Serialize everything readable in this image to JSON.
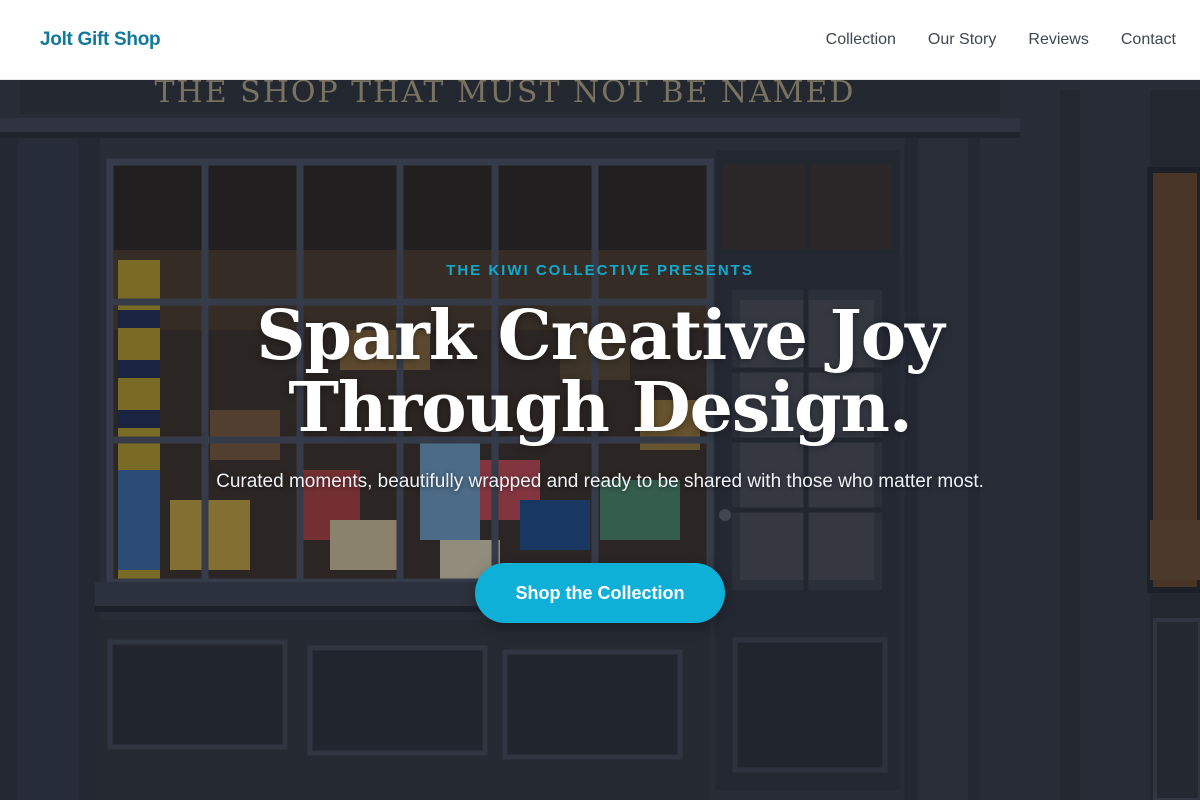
{
  "header": {
    "brand": "Jolt Gift Shop",
    "nav": [
      "Collection",
      "Our Story",
      "Reviews",
      "Contact"
    ]
  },
  "hero": {
    "sign_text": "THE SHOP THAT MUST NOT BE NAMED",
    "eyebrow": "THE KIWI COLLECTIVE PRESENTS",
    "headline_line1": "Spark Creative Joy",
    "headline_line2": "Through Design.",
    "subtext": "Curated moments, beautifully wrapped and ready to be shared with those who matter most.",
    "cta_label": "Shop the Collection"
  },
  "colors": {
    "brand": "#12799a",
    "accent": "#0fb0d8",
    "nav_text": "#3f4650",
    "storefront": "#343b48"
  }
}
